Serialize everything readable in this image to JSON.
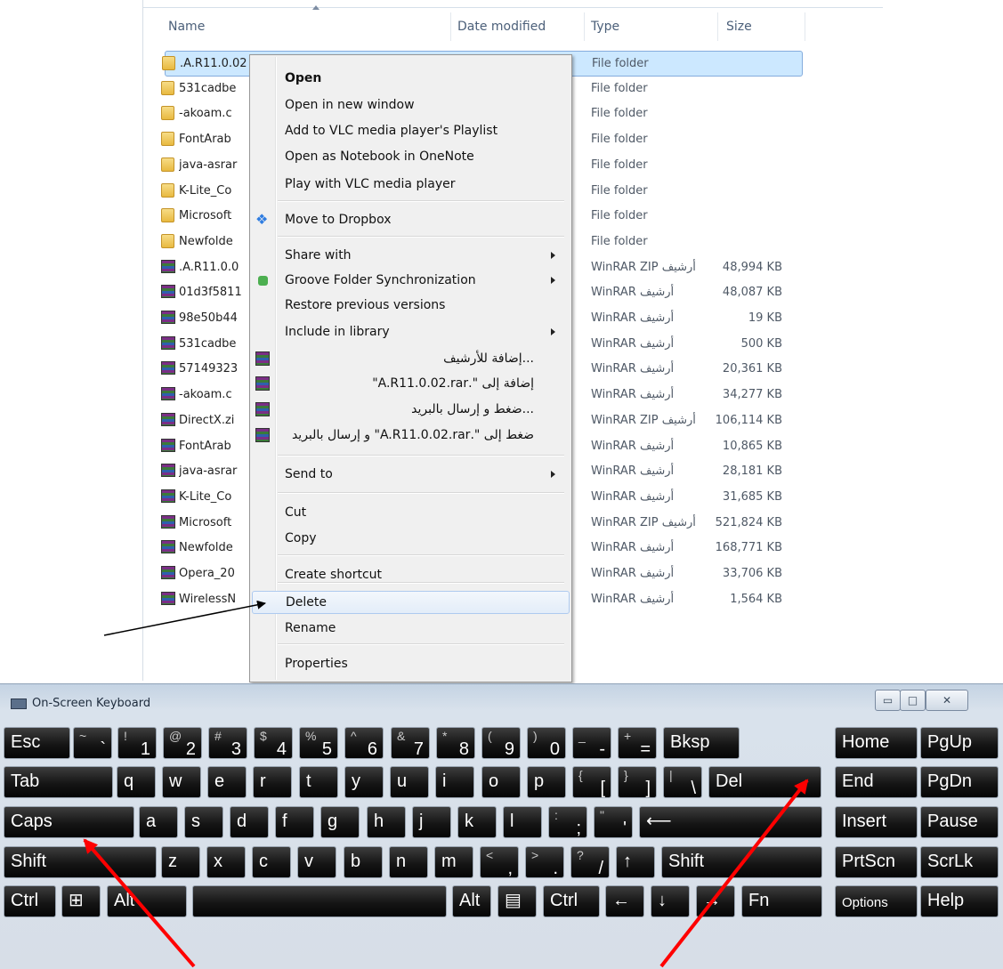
{
  "explorer": {
    "columns": {
      "name": "Name",
      "date": "Date modified",
      "type": "Type",
      "size": "Size"
    },
    "rows": [
      {
        "name": ".A.R11.0.02",
        "type": "File folder",
        "size": "",
        "kind": "folder",
        "selected": true
      },
      {
        "name": "531cadbe",
        "type": "File folder",
        "size": "",
        "kind": "folder"
      },
      {
        "name": "-akoam.c",
        "type": "File folder",
        "size": "",
        "kind": "folder"
      },
      {
        "name": "FontArab",
        "type": "File folder",
        "size": "",
        "kind": "folder"
      },
      {
        "name": "java-asrar",
        "type": "File folder",
        "size": "",
        "kind": "folder"
      },
      {
        "name": "K-Lite_Co",
        "type": "File folder",
        "size": "",
        "kind": "folder"
      },
      {
        "name": "Microsoft",
        "type": "File folder",
        "size": "",
        "kind": "folder"
      },
      {
        "name": "Newfolde",
        "type": "File folder",
        "size": "",
        "kind": "folder"
      },
      {
        "name": ".A.R11.0.0",
        "type": "WinRAR ZIP أرشيف",
        "size": "48,994 KB",
        "kind": "rar"
      },
      {
        "name": "01d3f5811",
        "type": "WinRAR أرشيف",
        "size": "48,087 KB",
        "kind": "rar"
      },
      {
        "name": "98e50b44",
        "type": "WinRAR أرشيف",
        "size": "19 KB",
        "kind": "rar"
      },
      {
        "name": "531cadbe",
        "type": "WinRAR أرشيف",
        "size": "500 KB",
        "kind": "rar"
      },
      {
        "name": "57149323",
        "type": "WinRAR أرشيف",
        "size": "20,361 KB",
        "kind": "rar"
      },
      {
        "name": "-akoam.c",
        "type": "WinRAR أرشيف",
        "size": "34,277 KB",
        "kind": "rar"
      },
      {
        "name": "DirectX.zi",
        "type": "WinRAR ZIP أرشيف",
        "size": "106,114 KB",
        "kind": "rar"
      },
      {
        "name": "FontArab",
        "type": "WinRAR أرشيف",
        "size": "10,865 KB",
        "kind": "rar"
      },
      {
        "name": "java-asrar",
        "type": "WinRAR أرشيف",
        "size": "28,181 KB",
        "kind": "rar"
      },
      {
        "name": "K-Lite_Co",
        "type": "WinRAR أرشيف",
        "size": "31,685 KB",
        "kind": "rar"
      },
      {
        "name": "Microsoft",
        "type": "WinRAR ZIP أرشيف",
        "size": "521,824 KB",
        "kind": "rar"
      },
      {
        "name": "Newfolde",
        "type": "WinRAR أرشيف",
        "size": "168,771 KB",
        "kind": "rar"
      },
      {
        "name": "Opera_20",
        "type": "WinRAR أرشيف",
        "size": "33,706 KB",
        "kind": "rar"
      },
      {
        "name": "WirelessN",
        "type": "WinRAR أرشيف",
        "size": "1,564 KB",
        "kind": "rar"
      }
    ]
  },
  "context_menu": {
    "items": [
      {
        "label": "Open",
        "bold": true
      },
      {
        "label": "Open in new window"
      },
      {
        "label": "Add to VLC media player's Playlist"
      },
      {
        "label": "Open as Notebook in OneNote"
      },
      {
        "label": "Play with VLC media player"
      },
      {
        "label": "Move to Dropbox",
        "icon": "dropbox-icon"
      },
      {
        "label": "Share with",
        "submenu": true
      },
      {
        "label": "Groove Folder Synchronization",
        "icon": "groove-icon",
        "submenu": true
      },
      {
        "label": "Restore previous versions"
      },
      {
        "label": "Include in library",
        "submenu": true
      },
      {
        "label": "...إضافة للأرشيف",
        "icon": "winrar-icon",
        "rtl": true
      },
      {
        "label": "إضافة إلى \".A.R11.0.02.rar\"",
        "icon": "winrar-icon",
        "rtl": true
      },
      {
        "label": "...ضغط و إرسال بالبريد",
        "icon": "winrar-icon",
        "rtl": true
      },
      {
        "label": "ضغط إلى \".A.R11.0.02.rar\" و إرسال بالبريد",
        "icon": "winrar-icon",
        "rtl": true
      },
      {
        "label": "Send to",
        "submenu": true
      },
      {
        "label": "Cut"
      },
      {
        "label": "Copy"
      },
      {
        "label": "Create shortcut"
      },
      {
        "label": "Delete",
        "highlighted": true
      },
      {
        "label": "Rename"
      },
      {
        "label": "Properties"
      }
    ]
  },
  "keyboard": {
    "title": "On-Screen Keyboard",
    "keys": {
      "esc": "Esc",
      "tilde_sh": "~",
      "tilde": "`",
      "k1s": "!",
      "k1": "1",
      "k2s": "@",
      "k2": "2",
      "k3s": "#",
      "k3": "3",
      "k4s": "$",
      "k4": "4",
      "k5s": "%",
      "k5": "5",
      "k6s": "^",
      "k6": "6",
      "k7s": "&",
      "k7": "7",
      "k8s": "*",
      "k8": "8",
      "k9s": "(",
      "k9": "9",
      "k0s": ")",
      "k0": "0",
      "minus_s": "_",
      "minus": "-",
      "eq_s": "+",
      "eq": "=",
      "bksp": "Bksp",
      "home": "Home",
      "pgup": "PgUp",
      "tab": "Tab",
      "q": "q",
      "w": "w",
      "e": "e",
      "r": "r",
      "t": "t",
      "y": "y",
      "u": "u",
      "i": "i",
      "o": "o",
      "p": "p",
      "lbr_s": "{",
      "lbr": "[",
      "rbr_s": "}",
      "rbr": "]",
      "bsl_s": "|",
      "bsl": "\\",
      "del": "Del",
      "end": "End",
      "pgdn": "PgDn",
      "caps": "Caps",
      "a": "a",
      "s": "s",
      "d": "d",
      "f": "f",
      "g": "g",
      "h": "h",
      "j": "j",
      "k": "k",
      "l": "l",
      "semi_s": ":",
      "semi": ";",
      "quote_s": "\"",
      "quote": "'",
      "enter": "⟵",
      "insert": "Insert",
      "pause": "Pause",
      "shift": "Shift",
      "z": "z",
      "x": "x",
      "c": "c",
      "v": "v",
      "b": "b",
      "n": "n",
      "m": "m",
      "comma_s": "<",
      "comma": ",",
      "dot_s": ">",
      "dot": ".",
      "slash_s": "?",
      "slash": "/",
      "up": "↑",
      "rshift": "Shift",
      "prtscn": "PrtScn",
      "scrlk": "ScrLk",
      "ctrl": "Ctrl",
      "win": "⊞",
      "alt": "Alt",
      "ralt": "Alt",
      "menu": "▤",
      "rctrl": "Ctrl",
      "left": "←",
      "down": "↓",
      "right": "→",
      "fn": "Fn",
      "options": "Options",
      "help": "Help"
    }
  },
  "colors": {
    "arrow_red": "#ff0000",
    "selection": "#cce8ff",
    "key_bg": "#111111"
  }
}
